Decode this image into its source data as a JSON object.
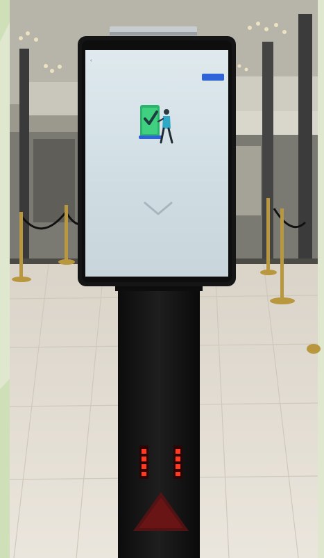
{
  "scene": {
    "screen": {
      "header_title": "",
      "action_button_label": "",
      "back_icon": "back-arrow-icon",
      "illustration_icon": "phone-checkmark-person-icon",
      "illustration_title": "",
      "illustration_text": "",
      "chevron_icon": "chevron-down-icon",
      "button_color": "#2f63d8"
    },
    "led_display": {
      "left_digit": "",
      "right_digit": ""
    },
    "colors": {
      "led": "#ff3a22",
      "pillar": "#151515",
      "floor": "#e6e0d6"
    }
  }
}
